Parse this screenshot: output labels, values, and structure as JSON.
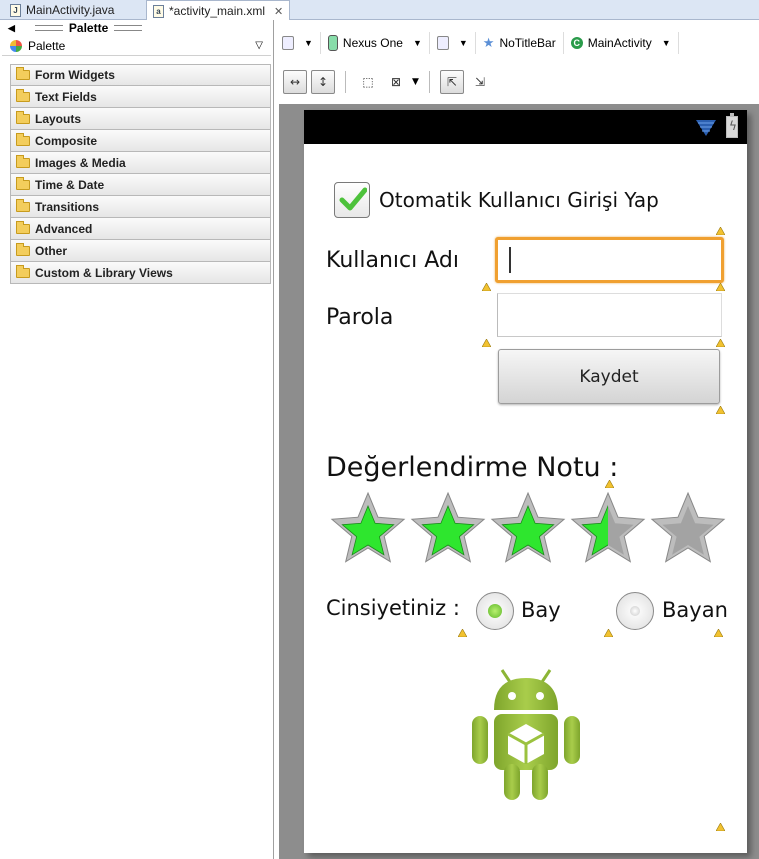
{
  "editor_tabs": [
    {
      "label": "MainActivity.java",
      "icon": "java-file-icon",
      "active": false
    },
    {
      "label": "*activity_main.xml",
      "icon": "xml-file-icon",
      "active": true
    }
  ],
  "palette": {
    "header": "Palette",
    "selector": "Palette",
    "categories": [
      "Form Widgets",
      "Text Fields",
      "Layouts",
      "Composite",
      "Images & Media",
      "Time & Date",
      "Transitions",
      "Advanced",
      "Other",
      "Custom & Library Views"
    ]
  },
  "toolbar": {
    "device": "Nexus One",
    "theme": "NoTitleBar",
    "activity": "MainActivity"
  },
  "app": {
    "checkbox_label": "Otomatik Kullanıcı Girişi Yap",
    "checkbox_checked": true,
    "username_label": "Kullanıcı Adı",
    "username_value": "",
    "password_label": "Parola",
    "password_value": "",
    "save_button": "Kaydet",
    "rating_label": "Değerlendirme Notu :",
    "rating_value": 3.5,
    "rating_max": 5,
    "gender_label": "Cinsiyetiniz :",
    "gender_options": [
      {
        "label": "Bay",
        "selected": true
      },
      {
        "label": "Bayan",
        "selected": false
      }
    ]
  },
  "colors": {
    "focus_orange": "#f0a030",
    "star_green": "#2ee62e",
    "radio_green": "#7fd63a",
    "android_green": "#97c03d"
  }
}
